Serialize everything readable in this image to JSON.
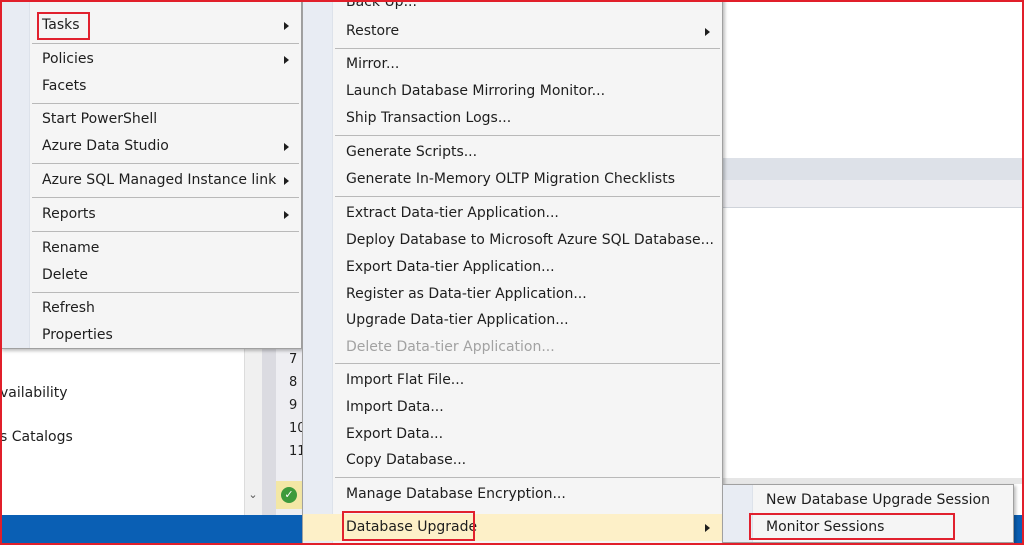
{
  "context_menu": {
    "items": [
      {
        "label": "Tasks",
        "submenu": true
      },
      {
        "label": "Policies",
        "submenu": true
      },
      {
        "label": "Facets",
        "submenu": false
      },
      {
        "label": "Start PowerShell",
        "submenu": false
      },
      {
        "label": "Azure Data Studio",
        "submenu": true
      },
      {
        "label": "Azure SQL Managed Instance link",
        "submenu": true
      },
      {
        "label": "Reports",
        "submenu": true
      },
      {
        "label": "Rename",
        "submenu": false
      },
      {
        "label": "Delete",
        "submenu": false
      },
      {
        "label": "Refresh",
        "submenu": false
      },
      {
        "label": "Properties",
        "submenu": false
      }
    ]
  },
  "tasks_menu": {
    "items": [
      {
        "label": "Back Up..."
      },
      {
        "label": "Restore",
        "submenu": true
      },
      {
        "label": "Mirror..."
      },
      {
        "label": "Launch Database Mirroring Monitor..."
      },
      {
        "label": "Ship Transaction Logs..."
      },
      {
        "label": "Generate Scripts..."
      },
      {
        "label": "Generate In-Memory OLTP Migration Checklists"
      },
      {
        "label": "Extract Data-tier Application..."
      },
      {
        "label": "Deploy Database to Microsoft Azure SQL Database..."
      },
      {
        "label": "Export Data-tier Application..."
      },
      {
        "label": "Register as Data-tier Application..."
      },
      {
        "label": "Upgrade Data-tier Application..."
      },
      {
        "label": "Delete Data-tier Application...",
        "disabled": true
      },
      {
        "label": "Import Flat File..."
      },
      {
        "label": "Import Data..."
      },
      {
        "label": "Export Data..."
      },
      {
        "label": "Copy Database..."
      },
      {
        "label": "Manage Database Encryption..."
      },
      {
        "label": "Database Upgrade",
        "submenu": true
      }
    ]
  },
  "upgrade_menu": {
    "items": [
      {
        "label": "New Database Upgrade Session"
      },
      {
        "label": "Monitor Sessions"
      }
    ]
  },
  "explorer": {
    "items": [
      "vailability",
      "s Catalogs"
    ]
  },
  "editor": {
    "line_numbers": [
      "7",
      "8",
      "9",
      "10",
      "11"
    ]
  },
  "colors": {
    "highlight_red": "#e1212e",
    "menu_bg": "#f5f5f5",
    "hover_bg": "#fdf0c8",
    "taskbar": "#0a5fb4"
  }
}
